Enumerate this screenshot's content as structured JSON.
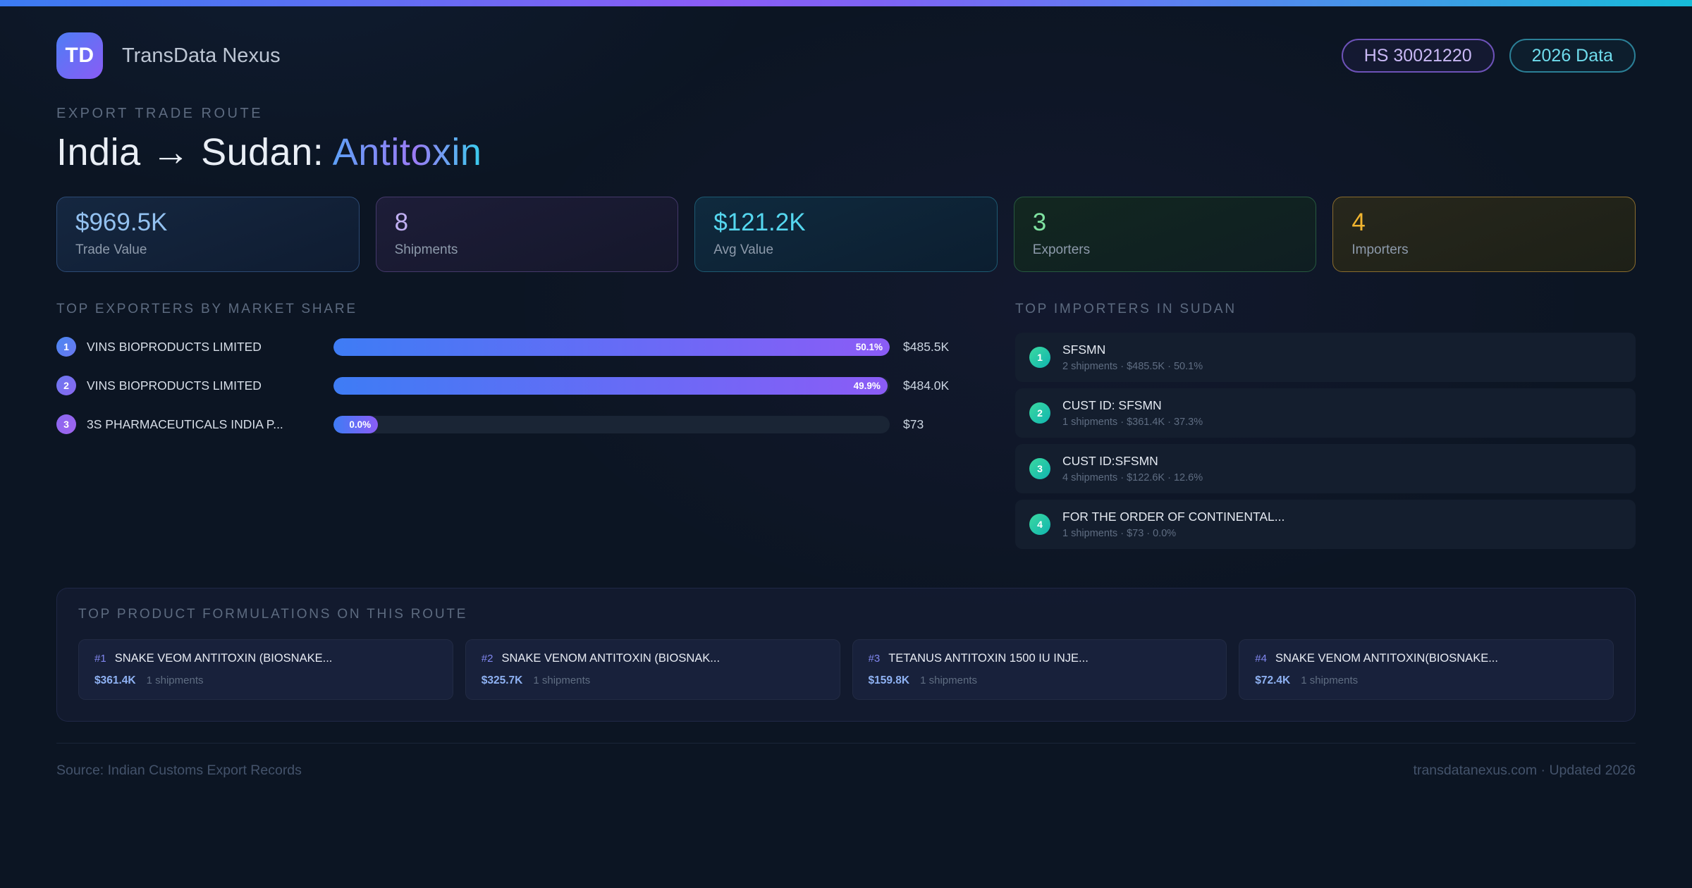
{
  "colors": {
    "accent_bar_gradient": [
      "#3b7bf2",
      "#8b5cf6",
      "#16bcd9"
    ],
    "brand_gradient": [
      "#4e7df5",
      "#8a5cf5"
    ],
    "bar_gradient": [
      "#3e7cf5",
      "#8b5cf6"
    ],
    "importer_badge_gradient": [
      "#3bd9a0",
      "#10b5b0"
    ],
    "title_accent_gradient": [
      "#5ea0f7",
      "#9b7bf5",
      "#38cdee"
    ]
  },
  "header": {
    "logo_initials": "TD",
    "app_name": "TransData Nexus",
    "hs_badge": "HS 30021220",
    "year_badge": "2026 Data"
  },
  "hero": {
    "eyebrow": "EXPORT TRADE ROUTE",
    "title_main": "India → Sudan: ",
    "title_accent": "Antitoxin"
  },
  "stats": [
    {
      "value": "$969.5K",
      "label": "Trade Value",
      "color": "#93c1f0"
    },
    {
      "value": "8",
      "label": "Shipments",
      "color": "#c0aff2"
    },
    {
      "value": "$121.2K",
      "label": "Avg Value",
      "color": "#55d7ef"
    },
    {
      "value": "3",
      "label": "Exporters",
      "color": "#7fe3a1"
    },
    {
      "value": "4",
      "label": "Importers",
      "color": "#f0b42f"
    }
  ],
  "exporters": {
    "heading": "TOP EXPORTERS BY MARKET SHARE",
    "rows": [
      {
        "rank": "1",
        "name": "VINS BIOPRODUCTS LIMITED",
        "share": "50.1%",
        "value": "$485.5K",
        "bar_pct": 100
      },
      {
        "rank": "2",
        "name": "VINS BIOPRODUCTS LIMITED",
        "share": "49.9%",
        "value": "$484.0K",
        "bar_pct": 99.6
      },
      {
        "rank": "3",
        "name": "3S PHARMACEUTICALS INDIA P...",
        "share": "0.0%",
        "value": "$73",
        "bar_pct": 8
      }
    ]
  },
  "importers": {
    "heading": "TOP IMPORTERS IN SUDAN",
    "rows": [
      {
        "rank": "1",
        "name": "SFSMN",
        "meta": "2 shipments · $485.5K · 50.1%"
      },
      {
        "rank": "2",
        "name": "CUST ID: SFSMN",
        "meta": "1 shipments · $361.4K · 37.3%"
      },
      {
        "rank": "3",
        "name": "CUST ID:SFSMN",
        "meta": "4 shipments · $122.6K · 12.6%"
      },
      {
        "rank": "4",
        "name": "FOR THE ORDER OF CONTINENTAL...",
        "meta": "1 shipments · $73 · 0.0%"
      }
    ]
  },
  "formulations": {
    "heading": "TOP PRODUCT FORMULATIONS ON THIS ROUTE",
    "cards": [
      {
        "rank": "#1",
        "name": "SNAKE VEOM ANTITOXIN (BIOSNAKE...",
        "value": "$361.4K",
        "shipments": "1 shipments"
      },
      {
        "rank": "#2",
        "name": "SNAKE VENOM ANTITOXIN (BIOSNAK...",
        "value": "$325.7K",
        "shipments": "1 shipments"
      },
      {
        "rank": "#3",
        "name": "TETANUS ANTITOXIN 1500 IU INJE...",
        "value": "$159.8K",
        "shipments": "1 shipments"
      },
      {
        "rank": "#4",
        "name": "SNAKE VENOM ANTITOXIN(BIOSNAKE...",
        "value": "$72.4K",
        "shipments": "1 shipments"
      }
    ]
  },
  "footer": {
    "source": "Source: Indian Customs Export Records",
    "site": "transdatanexus.com · Updated 2026"
  }
}
